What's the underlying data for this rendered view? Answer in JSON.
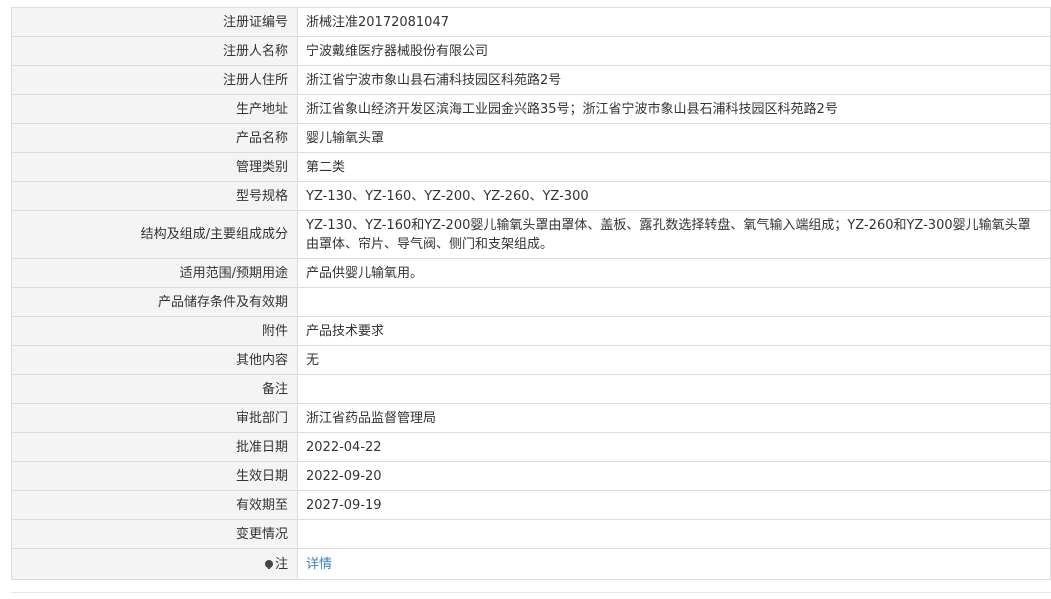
{
  "rows": [
    {
      "label": "注册证编号",
      "value": "浙械注准20172081047"
    },
    {
      "label": "注册人名称",
      "value": "宁波戴维医疗器械股份有限公司"
    },
    {
      "label": "注册人住所",
      "value": "浙江省宁波市象山县石浦科技园区科苑路2号"
    },
    {
      "label": "生产地址",
      "value": "浙江省象山经济开发区滨海工业园金兴路35号；浙江省宁波市象山县石浦科技园区科苑路2号"
    },
    {
      "label": "产品名称",
      "value": "婴儿输氧头罩"
    },
    {
      "label": "管理类别",
      "value": "第二类"
    },
    {
      "label": "型号规格",
      "value": "YZ-130、YZ-160、YZ-200、YZ-260、YZ-300"
    },
    {
      "label": "结构及组成/主要组成成分",
      "value": "YZ-130、YZ-160和YZ-200婴儿输氧头罩由罩体、盖板、露孔数选择转盘、氧气输入端组成；YZ-260和YZ-300婴儿输氧头罩由罩体、帘片、导气阀、侧门和支架组成。"
    },
    {
      "label": "适用范围/预期用途",
      "value": "产品供婴儿输氧用。"
    },
    {
      "label": "产品储存条件及有效期",
      "value": ""
    },
    {
      "label": "附件",
      "value": "产品技术要求"
    },
    {
      "label": "其他内容",
      "value": "无"
    },
    {
      "label": "备注",
      "value": ""
    },
    {
      "label": "审批部门",
      "value": "浙江省药品监督管理局"
    },
    {
      "label": "批准日期",
      "value": "2022-04-22"
    },
    {
      "label": "生效日期",
      "value": "2022-09-20"
    },
    {
      "label": "有效期至",
      "value": "2027-09-19"
    },
    {
      "label": "变更情况",
      "value": ""
    }
  ],
  "note": {
    "icon": "lightbulb-icon",
    "label": "注",
    "link_text": "详情"
  },
  "colors": {
    "label_bg": "#f4f4f4",
    "border": "#dcdcdc",
    "link": "#3a7fc4"
  }
}
